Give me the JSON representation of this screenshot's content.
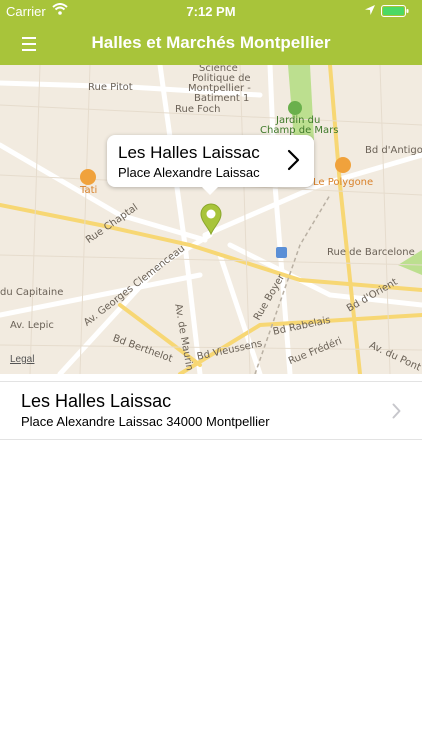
{
  "status_bar": {
    "carrier": "Carrier",
    "time": "7:12 PM"
  },
  "nav": {
    "title": "Halles et Marchés Montpellier"
  },
  "map": {
    "labels": {
      "science": "Science",
      "politique": "Politique de",
      "montpellier_bat": "Montpellier -",
      "batiment": "Batiment 1",
      "rue_pitot": "Rue Pitot",
      "rue_foch": "Rue Foch",
      "jardin1": "Jardin du",
      "jardin2": "Champ de Mars",
      "bd_antigone": "Bd d'Antigon",
      "tati": "Tati",
      "le_polygone": "Le Polygone",
      "rue_chaptal": "Rue Chaptal",
      "rue_barcelone": "Rue de Barcelone",
      "du_capitaine": "du Capitaine",
      "av_lepic": "Av. Lepic",
      "av_clemenceau": "Av. Georges Clemenceau",
      "bd_berthelot": "Bd Berthelot",
      "av_maurin": "Av. de Maurin",
      "rue_boyer": "Rue Boyer",
      "bd_rabelais": "Bd Rabelais",
      "bd_orient": "Bd d'Orient",
      "bd_vieussens": "Bd Vieussens",
      "rue_frederic": "Rue Frédéri",
      "av_pont": "Av. du Pont T",
      "legal": "Legal"
    },
    "callout": {
      "title": "Les Halles Laissac",
      "subtitle": "Place Alexandre Laissac"
    }
  },
  "list": [
    {
      "title": "Les Halles Laissac",
      "subtitle": "Place Alexandre Laissac 34000 Montpellier"
    }
  ],
  "colors": {
    "accent": "#a8c43a",
    "park": "#bcdf8f",
    "poi": "#f0a23c"
  }
}
